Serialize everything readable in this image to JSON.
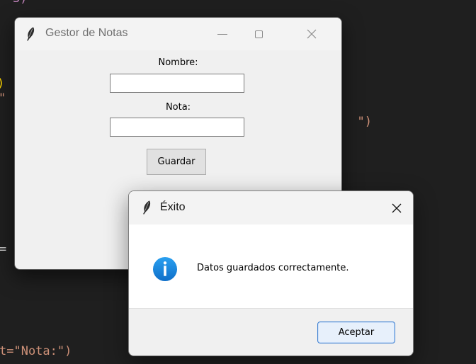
{
  "editor": {
    "fragments": {
      "top": "3)",
      "paren_left": ")",
      "quote_left": "\"",
      "quote_paren_right": "\")",
      "equals_left": "=",
      "bottom_code": "t=\"Nota:\")"
    }
  },
  "main_window": {
    "title": "Gestor de Notas",
    "icon": "feather-icon",
    "controls": {
      "minimize": "minimize-icon",
      "maximize": "maximize-icon",
      "close": "close-icon"
    },
    "form": {
      "name_label": "Nombre:",
      "name_value": "",
      "grade_label": "Nota:",
      "grade_value": "",
      "save_label": "Guardar"
    }
  },
  "dialog": {
    "title": "Éxito",
    "icon": "feather-icon",
    "close_icon": "close-icon",
    "message_icon": "info-icon",
    "message": "Datos guardados correctamente.",
    "accept_label": "Aceptar"
  },
  "colors": {
    "background": "#1f1f1f",
    "code_string": "#ce9178",
    "code_punctuation": "#ffd700",
    "dialog_button_border": "#3c7fd1",
    "info_blue": "#1e88e5"
  }
}
